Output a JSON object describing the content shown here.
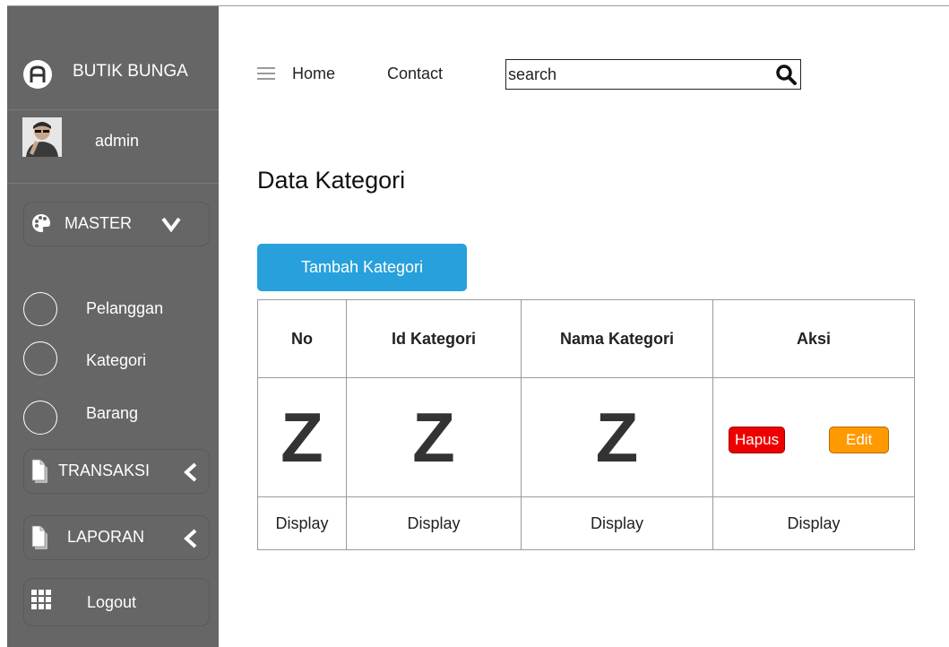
{
  "brand": {
    "name": "BUTIK BUNGA",
    "logo_icon": "brand-logo-icon"
  },
  "user": {
    "name": "admin"
  },
  "sidebar": {
    "master": {
      "label": "MASTER",
      "icon": "palette-icon"
    },
    "submenu": [
      {
        "label": "Pelanggan"
      },
      {
        "label": "Kategori"
      },
      {
        "label": "Barang"
      }
    ],
    "transaksi": {
      "label": "TRANSAKSI",
      "icon": "document-icon"
    },
    "laporan": {
      "label": "LAPORAN",
      "icon": "document-icon"
    },
    "logout": {
      "label": "Logout",
      "icon": "grid-icon"
    }
  },
  "topnav": {
    "home": "Home",
    "contact": "Contact",
    "search_value": "search"
  },
  "page": {
    "title": "Data Kategori",
    "add_button": "Tambah Kategori"
  },
  "table": {
    "headers": [
      "No",
      "Id Kategori",
      "Nama Kategori",
      "Aksi"
    ],
    "placeholder_row": [
      "Z",
      "Z",
      "Z"
    ],
    "actions": {
      "delete": "Hapus",
      "edit": "Edit"
    },
    "display_row": [
      "Display",
      "Display",
      "Display",
      "Display"
    ]
  },
  "colors": {
    "sidebar_bg": "#666666",
    "primary_button": "#27a0dc",
    "delete_button": "#ee0000",
    "edit_button": "#ff9900"
  }
}
